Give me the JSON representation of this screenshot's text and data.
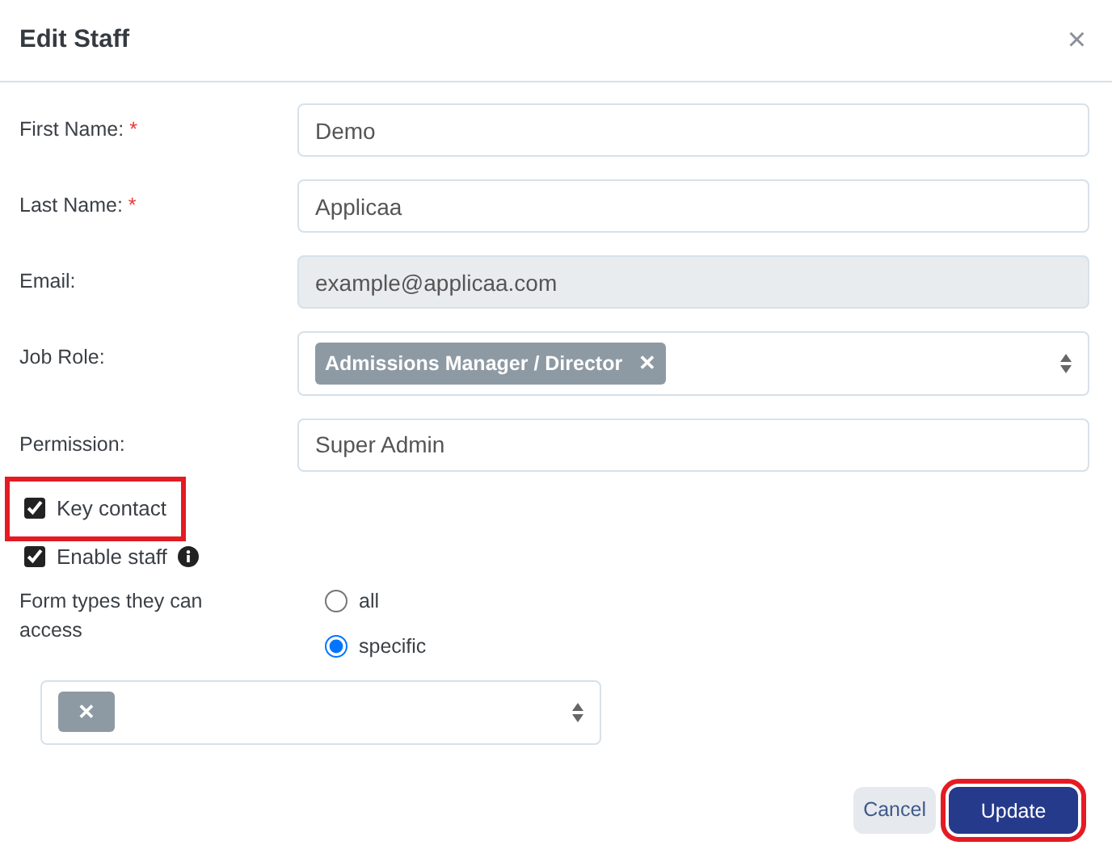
{
  "dialog": {
    "title": "Edit Staff",
    "close": "×"
  },
  "fields": [
    {
      "kind": "text",
      "label": "First Name:",
      "required_mark": "*",
      "value": "Demo"
    },
    {
      "kind": "text",
      "label": "Last Name:",
      "required_mark": "*",
      "value": "Applicaa"
    },
    {
      "kind": "disabled",
      "label": "Email:",
      "value": "example@applicaa.com"
    },
    {
      "kind": "tags",
      "label": "Job Role:",
      "tags": [
        {
          "label": "Admissions Manager / Director",
          "remove": "✕"
        }
      ]
    },
    {
      "kind": "select",
      "label": "Permission:",
      "value": "Super Admin"
    }
  ],
  "checkboxes": [
    {
      "label": "Key contact",
      "checked": true,
      "highlighted": true,
      "info": false
    },
    {
      "label": "Enable staff",
      "checked": true,
      "highlighted": false,
      "info": true
    }
  ],
  "form_types": {
    "label": "Form types they can access",
    "options": [
      {
        "label": "all",
        "selected": false
      },
      {
        "label": "specific",
        "selected": true
      }
    ],
    "tags": [
      {
        "remove": "✕"
      }
    ]
  },
  "buttons": [
    {
      "kind": "secondary",
      "label": "Cancel",
      "highlighted": false
    },
    {
      "kind": "primary",
      "label": "Update",
      "highlighted": true
    }
  ]
}
